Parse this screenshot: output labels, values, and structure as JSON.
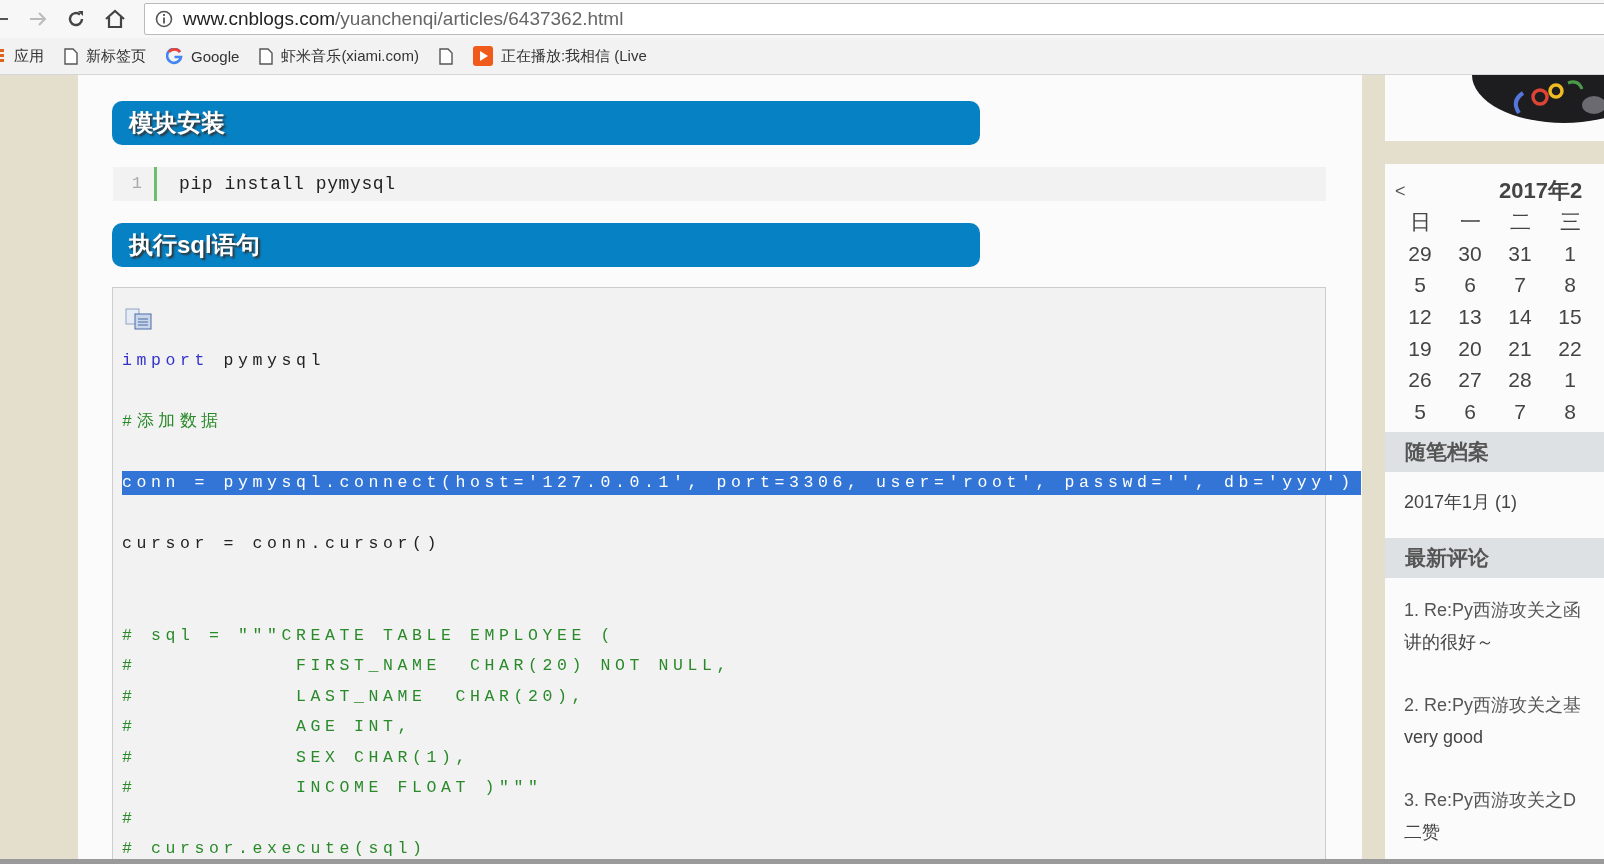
{
  "browser": {
    "url_host": "www.cnblogs.com",
    "url_path": "/yuanchenqi/articles/6437362.html",
    "bookmarks": [
      {
        "kind": "apps",
        "label": "应用"
      },
      {
        "kind": "page",
        "label": "新标签页"
      },
      {
        "kind": "google",
        "label": "Google"
      },
      {
        "kind": "page",
        "label": "虾米音乐(xiami.com)"
      },
      {
        "kind": "page"
      },
      {
        "kind": "play",
        "label": "正在播放:我相信 (Live"
      }
    ]
  },
  "article": {
    "sections": [
      {
        "heading": "模块安装",
        "kind": "numbered",
        "lines": [
          {
            "number": "1",
            "text": "pip install pymysql"
          }
        ]
      },
      {
        "heading": "执行sql语句",
        "kind": "block",
        "lines": [
          {
            "kind": "code",
            "selected": false,
            "tokens": [
              {
                "kind": "keyword",
                "text": "import"
              },
              {
                "kind": "plain",
                "text": " pymysql"
              }
            ]
          },
          {
            "kind": "blank"
          },
          {
            "kind": "code",
            "selected": false,
            "tokens": [
              {
                "kind": "comment",
                "text": "#添加数据"
              }
            ]
          },
          {
            "kind": "blank"
          },
          {
            "kind": "code",
            "selected": true,
            "tokens": [
              {
                "kind": "plain",
                "text": "conn = pymysql.connect(host='127.0.0.1', port=3306, user='root', passwd='', db='yyy')"
              }
            ]
          },
          {
            "kind": "blank"
          },
          {
            "kind": "code",
            "selected": false,
            "tokens": [
              {
                "kind": "plain",
                "text": "cursor = conn.cursor()"
              }
            ]
          },
          {
            "kind": "blank"
          },
          {
            "kind": "blank"
          },
          {
            "kind": "code",
            "selected": false,
            "tokens": [
              {
                "kind": "comment",
                "text": "# sql = \"\"\"CREATE TABLE EMPLOYEE ("
              }
            ]
          },
          {
            "kind": "code",
            "selected": false,
            "tokens": [
              {
                "kind": "comment",
                "text": "#           FIRST_NAME  CHAR(20) NOT NULL,"
              }
            ]
          },
          {
            "kind": "code",
            "selected": false,
            "tokens": [
              {
                "kind": "comment",
                "text": "#           LAST_NAME  CHAR(20),"
              }
            ]
          },
          {
            "kind": "code",
            "selected": false,
            "tokens": [
              {
                "kind": "comment",
                "text": "#           AGE INT,"
              }
            ]
          },
          {
            "kind": "code",
            "selected": false,
            "tokens": [
              {
                "kind": "comment",
                "text": "#           SEX CHAR(1),"
              }
            ]
          },
          {
            "kind": "code",
            "selected": false,
            "tokens": [
              {
                "kind": "comment",
                "text": "#           INCOME FLOAT )\"\"\""
              }
            ]
          },
          {
            "kind": "code",
            "selected": false,
            "tokens": [
              {
                "kind": "comment",
                "text": "#"
              }
            ]
          },
          {
            "kind": "code",
            "selected": false,
            "tokens": [
              {
                "kind": "comment",
                "text": "# cursor.execute(sql)"
              }
            ]
          }
        ]
      }
    ]
  },
  "sidebar": {
    "calendar": {
      "prev": "<",
      "title": "2017年2",
      "weekdays": [
        "日",
        "一",
        "二",
        "三"
      ],
      "weeks": [
        [
          "29",
          "30",
          "31",
          "1"
        ],
        [
          "5",
          "6",
          "7",
          "8"
        ],
        [
          "12",
          "13",
          "14",
          "15"
        ],
        [
          "19",
          "20",
          "21",
          "22"
        ],
        [
          "26",
          "27",
          "28",
          "1"
        ],
        [
          "5",
          "6",
          "7",
          "8"
        ]
      ]
    },
    "archive": {
      "title": "随笔档案",
      "items": [
        "2017年1月 (1)"
      ]
    },
    "comments": {
      "title": "最新评论",
      "items": [
        {
          "title": "1. Re:Py西游攻关之函",
          "body": "讲的很好～"
        },
        {
          "title": "2. Re:Py西游攻关之基",
          "body": "very good"
        },
        {
          "title": "3. Re:Py西游攻关之D",
          "body": "二赞"
        }
      ]
    }
  }
}
